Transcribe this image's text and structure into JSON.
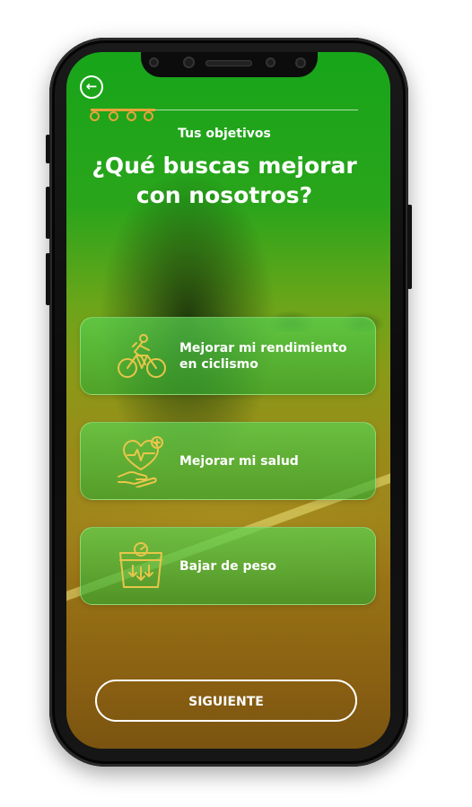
{
  "header": {
    "back_icon": "arrow-left-circle-icon",
    "progress": {
      "total_steps": 4,
      "current_step": 1
    }
  },
  "subtitle": "Tus objetivos",
  "title": "¿Qué buscas mejorar con nosotros?",
  "options": [
    {
      "label": "Mejorar mi rendimiento en ciclismo",
      "icon": "cyclist-icon"
    },
    {
      "label": "Mejorar mi salud",
      "icon": "health-heart-hand-icon"
    },
    {
      "label": "Bajar de peso",
      "icon": "scale-weight-icon"
    }
  ],
  "next_label": "SIGUIENTE",
  "colors": {
    "accent": "#e9a23b",
    "green": "#17a51a",
    "icon_stroke": "#e8c64a"
  }
}
